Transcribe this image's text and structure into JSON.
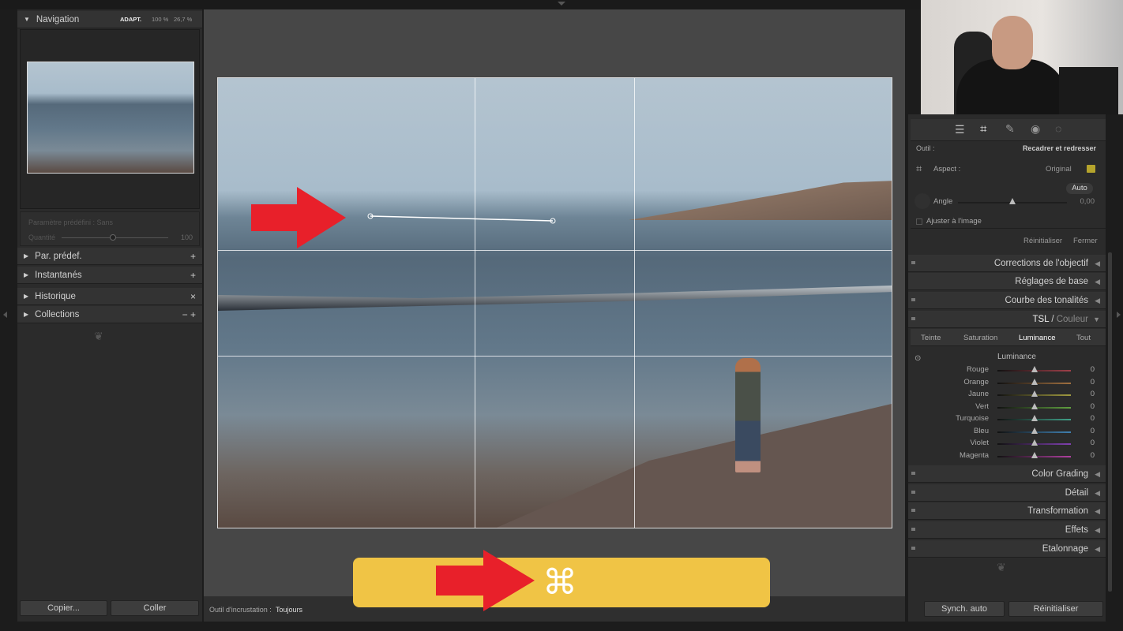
{
  "left": {
    "navigation": {
      "title": "Navigation",
      "zoom_options": [
        "ADAPT.",
        "100 %",
        "26,7 %"
      ]
    },
    "preset": {
      "label": "Paramètre prédéfini : Sans",
      "amount_label": "Quantité",
      "amount_value": "100"
    },
    "panels": [
      {
        "label": "Par. prédef.",
        "action": "+"
      },
      {
        "label": "Instantanés",
        "action": "+"
      },
      {
        "label": "Historique",
        "action": "×"
      },
      {
        "label": "Collections",
        "action": "− +"
      }
    ],
    "copy_button": "Copier...",
    "paste_button": "Coller"
  },
  "toolbar": {
    "overlay_label": "Outil d'incrustation :",
    "overlay_value": "Toujours"
  },
  "banner": {
    "shortcut": "⌘",
    "color": "#f0c445",
    "arrow_color": "#e8202a"
  },
  "right": {
    "tool_label": "Outil :",
    "tool_name": "Recadrer et redresser",
    "aspect_label": "Aspect :",
    "aspect_value": "Original",
    "auto_button": "Auto",
    "angle_label": "Angle",
    "angle_value": "0,00",
    "fit_label": "Ajuster à l'image",
    "reset": "Réinitialiser",
    "close": "Fermer",
    "sections_top": [
      "Corrections de l'objectif",
      "Réglages de base",
      "Courbe des tonalités"
    ],
    "tsl": {
      "title": "TSL",
      "title2": "Couleur",
      "tabs": [
        "Teinte",
        "Saturation",
        "Luminance",
        "Tout"
      ],
      "active_tab": "Luminance",
      "heading": "Luminance",
      "sliders": [
        {
          "label": "Rouge",
          "value": "0",
          "color": "#a0404a"
        },
        {
          "label": "Orange",
          "value": "0",
          "color": "#a07040"
        },
        {
          "label": "Jaune",
          "value": "0",
          "color": "#a09a40"
        },
        {
          "label": "Vert",
          "value": "0",
          "color": "#60a040"
        },
        {
          "label": "Turquoise",
          "value": "0",
          "color": "#40a088"
        },
        {
          "label": "Bleu",
          "value": "0",
          "color": "#4080b0"
        },
        {
          "label": "Violet",
          "value": "0",
          "color": "#8040b0"
        },
        {
          "label": "Magenta",
          "value": "0",
          "color": "#b040a0"
        }
      ]
    },
    "sections_bottom": [
      "Color Grading",
      "Détail",
      "Transformation",
      "Effets",
      "Etalonnage"
    ],
    "sync_button": "Synch. auto",
    "reset_button": "Réinitialiser"
  }
}
